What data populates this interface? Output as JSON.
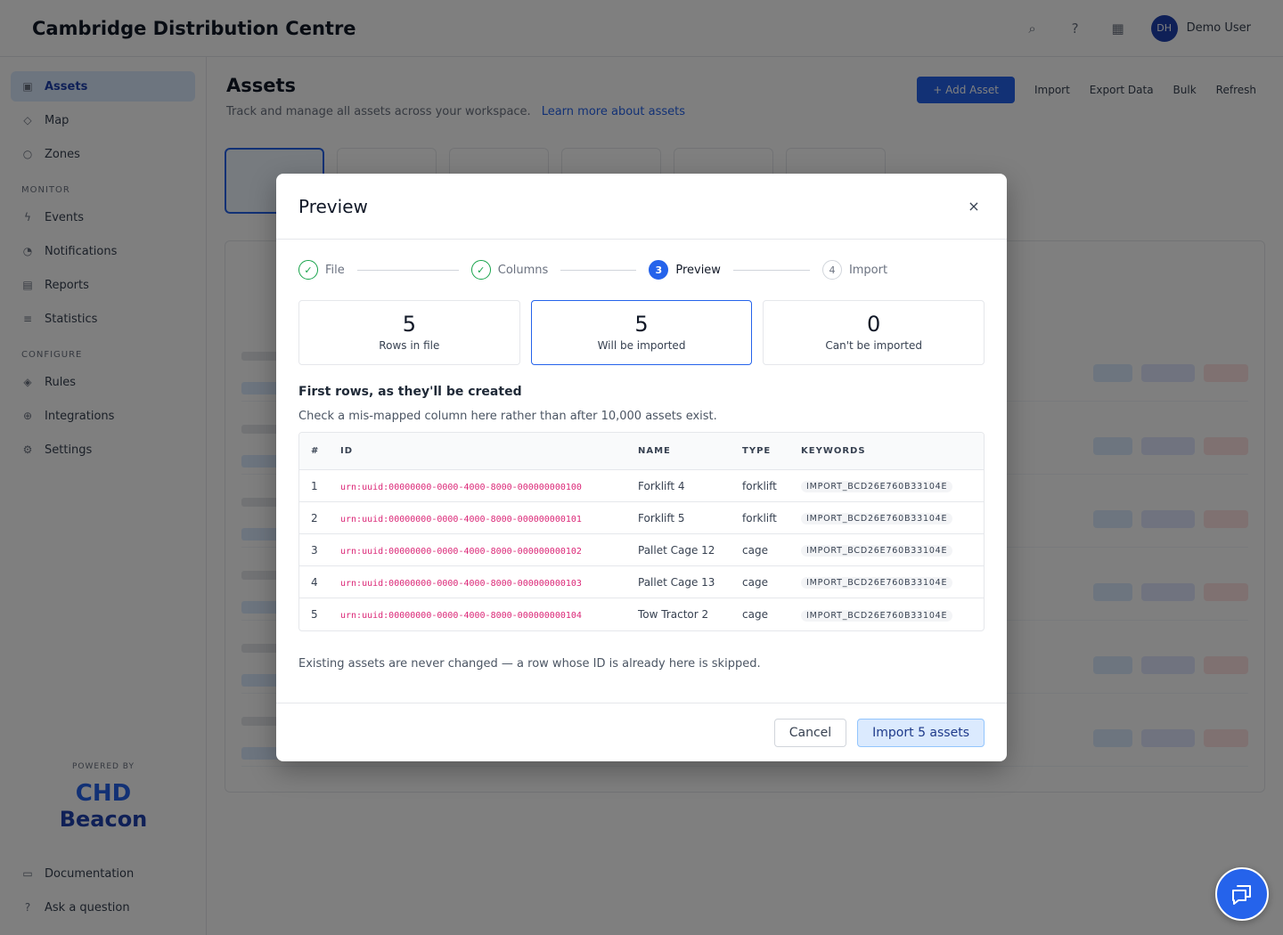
{
  "app": {
    "title": "Cambridge Distribution Centre",
    "user_initials": "DH",
    "user_name": "Demo User"
  },
  "sidebar": {
    "items": [
      {
        "label": "Assets",
        "icon": "box-icon",
        "active": true
      },
      {
        "label": "Map",
        "icon": "map-icon"
      },
      {
        "label": "Zones",
        "icon": "zone-icon"
      }
    ],
    "section_monitor": "MONITOR",
    "monitor_items": [
      {
        "label": "Events",
        "icon": "bolt-icon"
      },
      {
        "label": "Notifications",
        "icon": "bell-icon"
      },
      {
        "label": "Reports",
        "icon": "chart-icon"
      },
      {
        "label": "Statistics",
        "icon": "stats-icon"
      }
    ],
    "section_configure": "CONFIGURE",
    "configure_items": [
      {
        "label": "Rules",
        "icon": "rule-icon"
      },
      {
        "label": "Integrations",
        "icon": "plug-icon"
      },
      {
        "label": "Settings",
        "icon": "gear-icon"
      }
    ],
    "powered_by": "POWERED BY",
    "brand_line1": "CHD",
    "brand_line2": "Beacon",
    "bottom_items": [
      {
        "label": "Documentation",
        "icon": "doc-icon"
      },
      {
        "label": "Ask a question",
        "icon": "help-icon"
      }
    ]
  },
  "page": {
    "title": "Assets",
    "subtitle": "Track and manage all assets across your workspace.",
    "subtitle_link": "Learn more about assets",
    "add_label": "+ Add Asset",
    "import_label": "Import",
    "export_label": "Export Data",
    "bulk_label": "Bulk",
    "refresh_label": "Refresh"
  },
  "modal": {
    "title": "Preview",
    "close_label": "×",
    "steps": [
      {
        "marker": "✓",
        "label": "File",
        "state": "done"
      },
      {
        "marker": "✓",
        "label": "Columns",
        "state": "done"
      },
      {
        "marker": "3",
        "label": "Preview",
        "state": "current"
      },
      {
        "marker": "4",
        "label": "Import",
        "state": "todo"
      }
    ],
    "summary": [
      {
        "value": "5",
        "label": "Rows in file"
      },
      {
        "value": "5",
        "label": "Will be imported"
      },
      {
        "value": "0",
        "label": "Can't be imported"
      }
    ],
    "section_title": "First rows, as they'll be created",
    "section_sub": "Check a mis-mapped column here rather than after 10,000 assets exist.",
    "columns": [
      "#",
      "ID",
      "NAME",
      "TYPE",
      "KEYWORDS"
    ],
    "rows": [
      {
        "num": "1",
        "id": "urn:uuid:00000000-0000-4000-8000-000000000100",
        "name": "Forklift 4",
        "type": "forklift",
        "keyword": "IMPORT_BCD26E760B33104E"
      },
      {
        "num": "2",
        "id": "urn:uuid:00000000-0000-4000-8000-000000000101",
        "name": "Forklift 5",
        "type": "forklift",
        "keyword": "IMPORT_BCD26E760B33104E"
      },
      {
        "num": "3",
        "id": "urn:uuid:00000000-0000-4000-8000-000000000102",
        "name": "Pallet Cage 12",
        "type": "cage",
        "keyword": "IMPORT_BCD26E760B33104E"
      },
      {
        "num": "4",
        "id": "urn:uuid:00000000-0000-4000-8000-000000000103",
        "name": "Pallet Cage 13",
        "type": "cage",
        "keyword": "IMPORT_BCD26E760B33104E"
      },
      {
        "num": "5",
        "id": "urn:uuid:00000000-0000-4000-8000-000000000104",
        "name": "Tow Tractor 2",
        "type": "cage",
        "keyword": "IMPORT_BCD26E760B33104E"
      }
    ],
    "note": "Existing assets are never changed — a row whose ID is already here is skipped.",
    "cancel_label": "Cancel",
    "import_label": "Import 5 assets"
  },
  "colors": {
    "accent": "#2563eb",
    "success": "#16a34a",
    "id_text": "#db2777"
  }
}
